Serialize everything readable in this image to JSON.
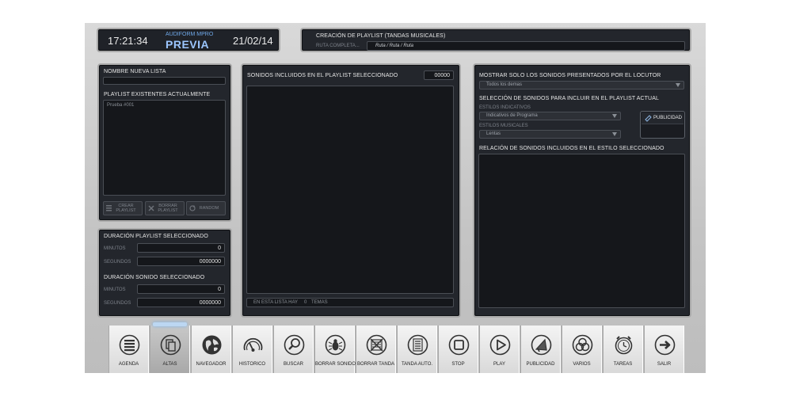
{
  "header": {
    "time": "17:21:34",
    "brand": "AUDIFORM MPRO",
    "mode": "PREVIA",
    "date": "21/02/14",
    "section_title": "CREACIÓN DE PLAYLIST (TANDAS MUSICALES)",
    "path_label": "RUTA COMPLETA...",
    "path_value": "Ruta / Ruta / Ruta"
  },
  "left": {
    "new_list_label": "NOMBRE NUEVA LISTA",
    "new_list_value": "",
    "existing_label": "PLAYLIST EXISTENTES ACTUALMENTE",
    "existing_items": [
      "Prueba #001"
    ],
    "buttons": {
      "create_line1": "CREAR",
      "create_line2": "PLAYLIST",
      "delete_line1": "BORRAR",
      "delete_line2": "PLAYLIST",
      "random": "RANDOM"
    }
  },
  "duration": {
    "playlist_title": "DURACIÓN PLAYLIST SELECCIONADO",
    "sound_title": "DURACIÓN SONIDO SELECCIONADO",
    "minutes_label": "MINUTOS",
    "seconds_label": "SEGUNDOS",
    "playlist_minutes": "0",
    "playlist_seconds": "0000000",
    "sound_minutes": "0",
    "sound_seconds": "0000000"
  },
  "middle": {
    "title": "SONIDOS INCLUIDOS EN EL PLAYLIST SELECCIONADO",
    "count": "00000",
    "footer_label": "EN ESTA LISTA HAY",
    "footer_count": "0",
    "footer_unit": "TEMAS"
  },
  "right": {
    "show_label": "MOSTRAR SOLO LOS SONIDOS PRESENTADOS POR EL LOCUTOR",
    "show_value": "Todos los demas",
    "selection_label": "SELECCIÓN DE SONIDOS PARA INCLUIR EN EL PLAYLIST ACTUAL",
    "indicative_label": "ESTILOS INDICATIVOS",
    "indicative_value": "Indicativos de Programa",
    "musical_label": "ESTILOS MUSICALES",
    "musical_value": "Lentas",
    "publicidad_button": "PUBLICIDAD",
    "relation_label": "RELACIÓN DE SONIDOS INCLUIDOS EN EL ESTILO SELECCIONADO"
  },
  "toolbar": [
    {
      "id": "agenda",
      "label": "AGENDA",
      "icon": "agenda-icon"
    },
    {
      "id": "altas",
      "label": "ALTAS",
      "icon": "altas-icon",
      "active": true
    },
    {
      "id": "navegador",
      "label": "NAVEGADOR",
      "icon": "globe-icon"
    },
    {
      "id": "historico",
      "label": "HISTORICO",
      "icon": "gauge-icon"
    },
    {
      "id": "buscar",
      "label": "BUSCAR",
      "icon": "search-icon"
    },
    {
      "id": "borrar-sonido",
      "label": "BORRAR SONIDO",
      "icon": "bug-icon"
    },
    {
      "id": "borrar-tanda",
      "label": "BORRAR TANDA",
      "icon": "crossed-list-icon"
    },
    {
      "id": "tanda-auto",
      "label": "TANDA AUTO.",
      "icon": "list-icon"
    },
    {
      "id": "stop",
      "label": "STOP",
      "icon": "stop-icon"
    },
    {
      "id": "play",
      "label": "PLAY",
      "icon": "play-icon"
    },
    {
      "id": "publicidad",
      "label": "PUBLICIDAD",
      "icon": "megaphone-icon"
    },
    {
      "id": "varios",
      "label": "VARIOS",
      "icon": "rings-icon"
    },
    {
      "id": "tareas",
      "label": "TAREAS",
      "icon": "alarm-icon"
    },
    {
      "id": "salir",
      "label": "SALIR",
      "icon": "exit-arrow-icon"
    }
  ]
}
